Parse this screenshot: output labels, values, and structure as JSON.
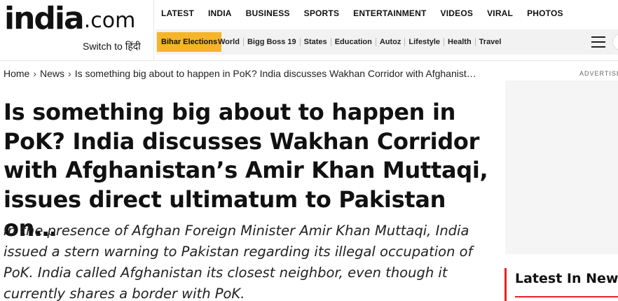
{
  "brand": {
    "logo_main": "india",
    "logo_suffix": ".com",
    "switch_label": "Switch to हिंदी"
  },
  "top_nav": [
    "LATEST",
    "INDIA",
    "BUSINESS",
    "SPORTS",
    "ENTERTAINMENT",
    "VIDEOS",
    "VIRAL",
    "PHOTOS"
  ],
  "sub_nav": {
    "highlight": "Bihar Elections",
    "items": [
      "World",
      "Bigg Boss 19",
      "States",
      "Education",
      "Autoz",
      "Lifestyle",
      "Health",
      "Travel"
    ]
  },
  "breadcrumb": {
    "home": "Home",
    "section": "News",
    "current": "Is something big about to happen in PoK? India discusses Wakhan Corridor with Afghanistan's Amir Khan Muttaqi"
  },
  "article": {
    "headline": "Is something big about to happen in PoK? India discusses Wakhan Corridor with Afghanistan’s Amir Khan Muttaqi, issues direct ultimatum to Pakistan on…",
    "summary": "In the presence of Afghan Foreign Minister Amir Khan Muttaqi, India issued a stern warning to Pakistan regarding its illegal occupation of PoK. India called Afghanistan its closest neighbor, even though it currently shares a border with PoK."
  },
  "sidebar": {
    "ad_label": "ADVERTISEMENT",
    "latest_title": "Latest In News"
  },
  "colors": {
    "accent_red": "#e8202a",
    "highlight_yellow": "#f5b52a"
  }
}
